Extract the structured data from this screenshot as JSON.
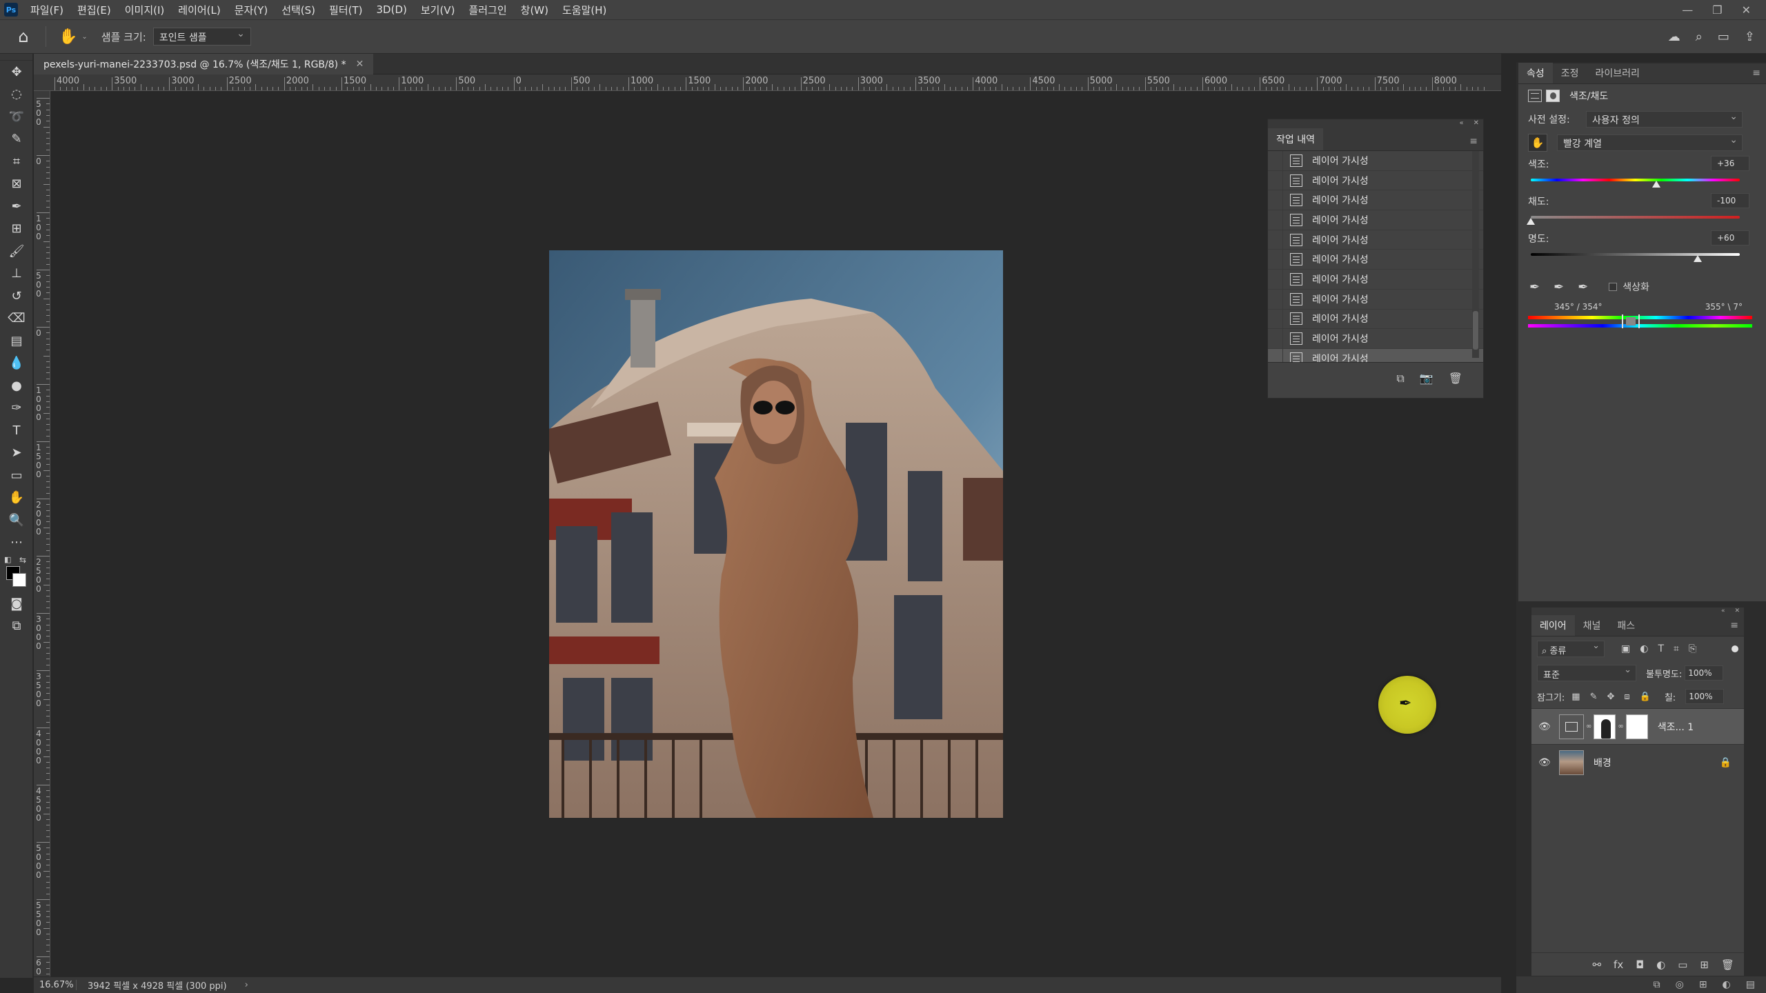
{
  "menubar": {
    "logo": "Ps",
    "items": [
      "파일(F)",
      "편집(E)",
      "이미지(I)",
      "레이어(L)",
      "문자(Y)",
      "선택(S)",
      "필터(T)",
      "3D(D)",
      "보기(V)",
      "플러그인",
      "창(W)",
      "도움말(H)"
    ]
  },
  "options": {
    "sample_size_label": "샘플 크기:",
    "sample_size_value": "포인트 샘플"
  },
  "document": {
    "tab_title": "pexels-yuri-manei-2233703.psd @ 16.7% (색조/채도 1, RGB/8) *",
    "zoom": "16.67%",
    "dimensions": "3942 픽셀 x 4928 픽셀 (300 ppi)"
  },
  "ruler": {
    "top_labels": [
      "4000",
      "3500",
      "3000",
      "2500",
      "2000",
      "1500",
      "1000",
      "500",
      "0",
      "500",
      "1000",
      "1500",
      "2000",
      "2500",
      "3000",
      "3500",
      "4000",
      "4500",
      "5000",
      "5500",
      "6000",
      "6500",
      "7000",
      "7500",
      "8000"
    ],
    "left_labels": [
      "500",
      "0",
      "100",
      "500",
      "0",
      "1000",
      "1500",
      "2000",
      "2500",
      "3000",
      "3500",
      "4000",
      "4500",
      "5000",
      "5500",
      "6000"
    ]
  },
  "history": {
    "title": "작업 내역",
    "items": [
      "레이어 가시성",
      "레이어 가시성",
      "레이어 가시성",
      "레이어 가시성",
      "레이어 가시성",
      "레이어 가시성",
      "레이어 가시성",
      "레이어 가시성",
      "레이어 가시성",
      "레이어 가시성",
      "레이어 가시성"
    ],
    "selected_index": 10
  },
  "properties": {
    "tabs": [
      "속성",
      "조정",
      "라이브러리"
    ],
    "active_tab": 0,
    "title": "색조/채도",
    "preset_label": "사전 설정:",
    "preset_value": "사용자 정의",
    "range_value": "빨강 계열",
    "hue_label": "색조:",
    "hue_value": "+36",
    "hue": 36,
    "saturation_label": "채도:",
    "saturation_value": "-100",
    "saturation": -100,
    "lightness_label": "명도:",
    "lightness_value": "+60",
    "lightness": 60,
    "colorize_label": "색상화",
    "range_left": "345° / 354°",
    "range_right": "355° \\ 7°"
  },
  "layers": {
    "tabs": [
      "레이어",
      "채널",
      "패스"
    ],
    "active_tab": 0,
    "kind_label": "종류",
    "blend_mode": "표준",
    "opacity_label": "불투명도:",
    "opacity_value": "100%",
    "lock_label": "잠그기:",
    "fill_label": "칠:",
    "fill_value": "100%",
    "items": [
      {
        "name": "색조... 1",
        "selected": true
      },
      {
        "name": "배경",
        "selected": false
      }
    ]
  },
  "colors": {
    "accent": "#595959",
    "cursor_highlight": "#d2d52c"
  }
}
